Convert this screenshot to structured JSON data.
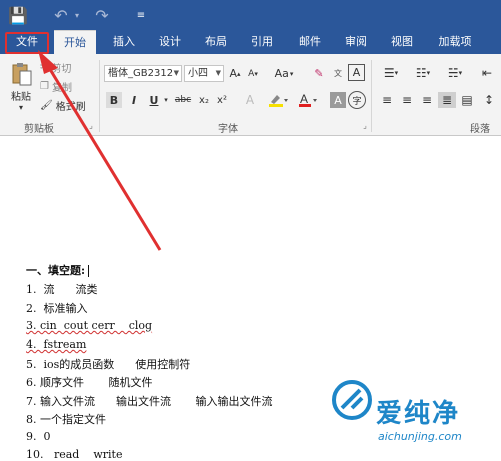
{
  "quick_access": {
    "save_icon": "💾",
    "undo_icon": "↶",
    "undo_dd": "▾",
    "redo_icon": "↷",
    "customize_icon": "≡"
  },
  "tabs": [
    {
      "id": "file",
      "label": "文件"
    },
    {
      "id": "home",
      "label": "开始"
    },
    {
      "id": "insert",
      "label": "插入"
    },
    {
      "id": "design",
      "label": "设计"
    },
    {
      "id": "layout",
      "label": "布局"
    },
    {
      "id": "references",
      "label": "引用"
    },
    {
      "id": "mailings",
      "label": "邮件"
    },
    {
      "id": "review",
      "label": "审阅"
    },
    {
      "id": "view",
      "label": "视图"
    },
    {
      "id": "addins",
      "label": "加载项"
    }
  ],
  "clipboard": {
    "paste_label": "粘贴",
    "cut_label": "剪切",
    "copy_label": "复制",
    "format_painter_label": "格式刷",
    "group_label": "剪贴板"
  },
  "font": {
    "font_name": "楷体_GB2312",
    "font_size": "小四",
    "grow": "A",
    "shrink": "A",
    "case_label": "Aa",
    "bold": "B",
    "italic": "I",
    "underline": "U",
    "strike": "abc",
    "subscript": "x₂",
    "superscript": "x²",
    "group_label": "字体"
  },
  "paragraph": {
    "group_label": "段落"
  },
  "document": {
    "heading": "一、填空题:",
    "lines": [
      "1.  流      流类",
      "2.  标准输入",
      "3. cin  cout cerr    clog",
      "4.  fstream",
      "5.  ios的成员函数      使用控制符",
      "6. 顺序文件       随机文件",
      "7. 输入文件流      输出文件流       输入输出文件流",
      "8. 一个指定文件",
      "9.  0",
      "10.   read    write"
    ]
  },
  "watermark": {
    "text": "爱纯净",
    "url": "aichunjing.com"
  },
  "colors": {
    "ribbon_blue": "#2b579a",
    "highlight_red": "#e03030",
    "watermark_blue": "#1e86c8"
  }
}
